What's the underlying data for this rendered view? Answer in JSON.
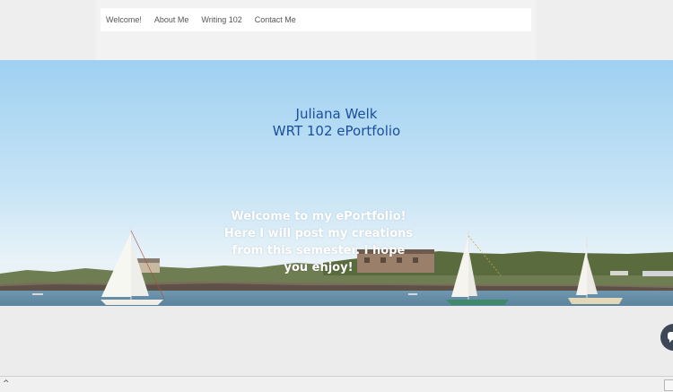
{
  "nav": {
    "items": [
      "Welcome!",
      "About Me",
      "Writing 102",
      "Contact Me"
    ]
  },
  "hero": {
    "title_line1": "Juliana Welk",
    "title_line2": "WRT 102 ePortfolio",
    "welcome_text": "Welcome to my ePortfolio! Here I will post my creations from this semester. I hope you enjoy!"
  },
  "status": {
    "scroll_icon": "chevron-up-icon"
  },
  "colors": {
    "title": "#1b4f9a",
    "welcome": "#ffffff",
    "chat": "#3c4856"
  }
}
